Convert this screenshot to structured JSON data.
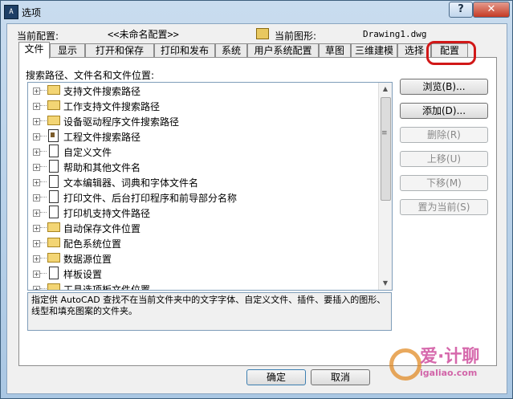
{
  "window": {
    "title": "选项",
    "icon": "app-icon",
    "help_label": "?",
    "close_label": "✕"
  },
  "header": {
    "config_label": "当前配置:",
    "config_value": "<<未命名配置>>",
    "drawing_label": "当前图形:",
    "drawing_value": "Drawing1.dwg"
  },
  "tabs": [
    {
      "label": "文件",
      "active": true
    },
    {
      "label": "显示"
    },
    {
      "label": "打开和保存"
    },
    {
      "label": "打印和发布"
    },
    {
      "label": "系统"
    },
    {
      "label": "用户系统配置"
    },
    {
      "label": "草图"
    },
    {
      "label": "三维建模"
    },
    {
      "label": "选择"
    },
    {
      "label": "配置",
      "highlighted": true
    }
  ],
  "panel": {
    "search_label": "搜索路径、文件名和文件位置:",
    "tree_items": [
      {
        "label": "支持文件搜索路径",
        "icon": "folder-icon"
      },
      {
        "label": "工作支持文件搜索路径",
        "icon": "folder-icon"
      },
      {
        "label": "设备驱动程序文件搜索路径",
        "icon": "folder-icon"
      },
      {
        "label": "工程文件搜索路径",
        "icon": "project-icon"
      },
      {
        "label": "自定义文件",
        "icon": "document-icon"
      },
      {
        "label": "帮助和其他文件名",
        "icon": "document-icon"
      },
      {
        "label": "文本编辑器、词典和字体文件名",
        "icon": "document-icon"
      },
      {
        "label": "打印文件、后台打印程序和前导部分名称",
        "icon": "document-icon"
      },
      {
        "label": "打印机支持文件路径",
        "icon": "document-icon"
      },
      {
        "label": "自动保存文件位置",
        "icon": "folder-icon"
      },
      {
        "label": "配色系统位置",
        "icon": "folder-icon"
      },
      {
        "label": "数据源位置",
        "icon": "folder-icon"
      },
      {
        "label": "样板设置",
        "icon": "document-icon"
      },
      {
        "label": "工具选项板文件位置",
        "icon": "folder-icon"
      }
    ],
    "description": "指定供 AutoCAD 查找不在当前文件夹中的文字字体、自定义文件、插件、要插入的图形、线型和填充图案的文件夹。"
  },
  "side_buttons": [
    {
      "label": "浏览(B)...",
      "enabled": true
    },
    {
      "label": "添加(D)...",
      "enabled": true
    },
    {
      "label": "删除(R)",
      "enabled": false
    },
    {
      "label": "上移(U)",
      "enabled": false
    },
    {
      "label": "下移(M)",
      "enabled": false
    },
    {
      "label": "置为当前(S)",
      "enabled": false
    }
  ],
  "footer": {
    "ok_label": "确定",
    "cancel_label": "取消"
  },
  "watermark": {
    "line1": "爱·计聊",
    "line2": "igaliao.com"
  },
  "colors": {
    "title_gradient_top": "#c9dcef",
    "title_gradient_bottom": "#aac7e3",
    "close_button": "#c53a24",
    "highlight_circle": "#d11818"
  }
}
